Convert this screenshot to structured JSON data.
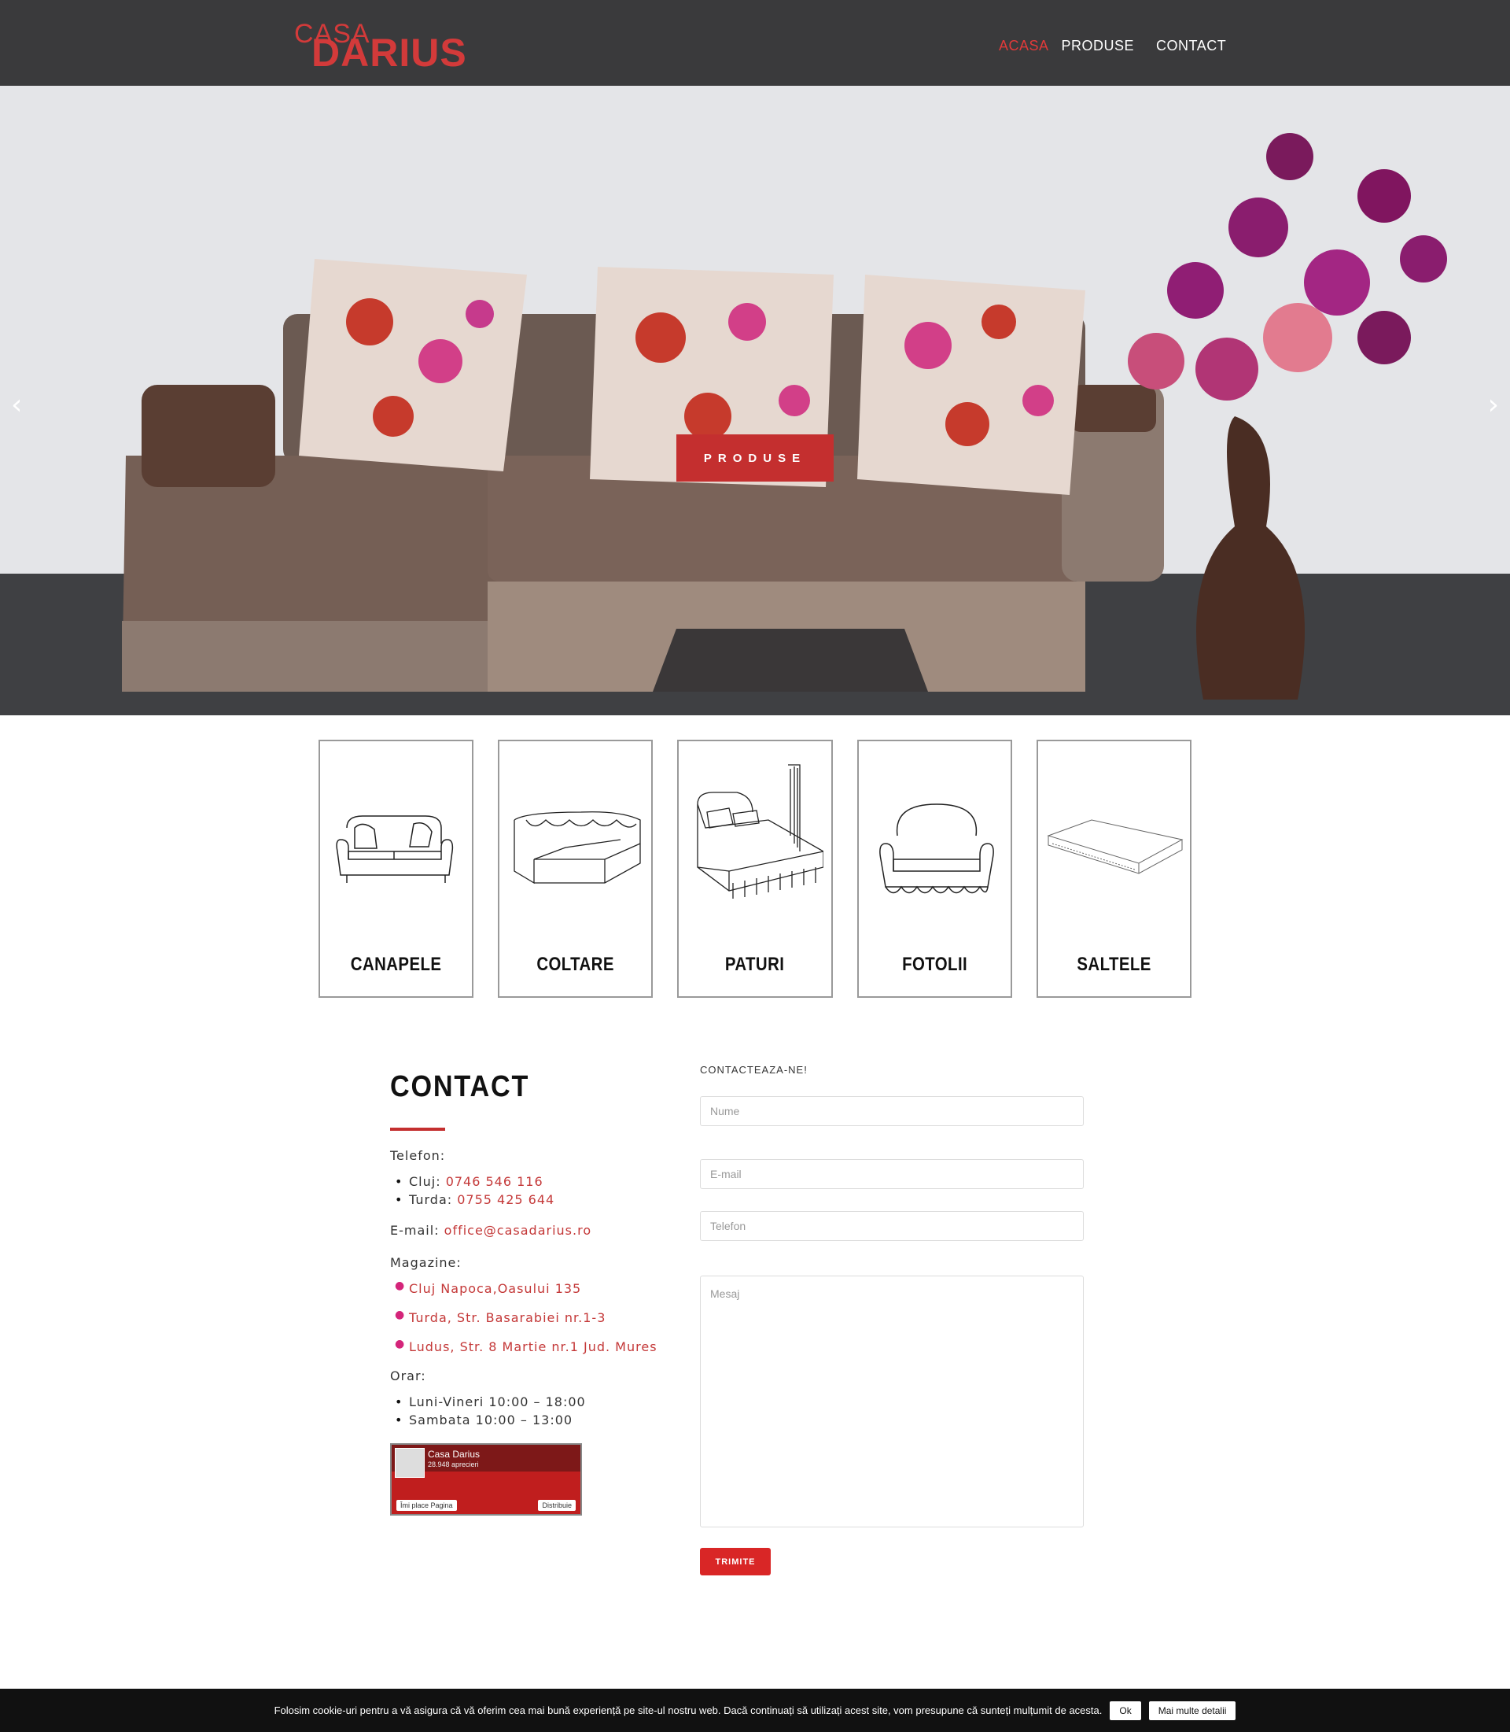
{
  "header": {
    "logo_top": "CASA",
    "logo_bottom": "DARIUS",
    "nav": [
      {
        "label": "ACASA",
        "active": true
      },
      {
        "label": "PRODUSE",
        "active": false
      },
      {
        "label": "CONTACT",
        "active": false
      }
    ]
  },
  "hero": {
    "button_label": "PRODUSE",
    "prev_icon": "chevron-left-icon",
    "next_icon": "chevron-right-icon",
    "prev_glyph": "‹",
    "next_glyph": "›"
  },
  "categories": [
    {
      "label": "CANAPELE",
      "icon": "sofa-icon"
    },
    {
      "label": "COLTARE",
      "icon": "corner-sofa-icon"
    },
    {
      "label": "PATURI",
      "icon": "bed-icon"
    },
    {
      "label": "FOTOLII",
      "icon": "armchair-icon"
    },
    {
      "label": "SALTELE",
      "icon": "mattress-icon"
    }
  ],
  "contact": {
    "title": "CONTACT",
    "phone_label": "Telefon:",
    "phones": [
      {
        "city": "Cluj:",
        "number": "0746 546 116"
      },
      {
        "city": "Turda:",
        "number": "0755 425 644"
      }
    ],
    "email_label": "E-mail:",
    "email": "office@casadarius.ro",
    "shops_label": "Magazine:",
    "shops": [
      "Cluj Napoca,Oasului 135",
      "Turda, Str. Basarabiei nr.1-3",
      "Ludus, Str. 8 Martie nr.1 Jud. Mures"
    ],
    "hours_label": "Orar:",
    "hours": [
      "Luni-Vineri 10:00 – 18:00",
      "Sambata 10:00 – 13:00"
    ],
    "facebook": {
      "name": "Casa Darius",
      "likes": "28.948 aprecieri",
      "like_label": "Îmi place Pagina",
      "share_label": "Distribuie"
    }
  },
  "form": {
    "heading": "CONTACTEAZA-NE!",
    "name_placeholder": "Nume",
    "email_placeholder": "E-mail",
    "phone_placeholder": "Telefon",
    "message_placeholder": "Mesaj",
    "submit_label": "TRIMITE"
  },
  "cookie": {
    "text": "Folosim cookie-uri pentru a vă asigura că vă oferim cea mai bună experiență pe site-ul nostru web. Dacă continuați să utilizați acest site, vom presupune că sunteți mulțumit de acesta.",
    "ok_label": "Ok",
    "more_label": "Mai multe detalii"
  },
  "colors": {
    "header_bg": "#3a3a3c",
    "accent": "#c42f2f",
    "cookie_bg": "#111111"
  }
}
